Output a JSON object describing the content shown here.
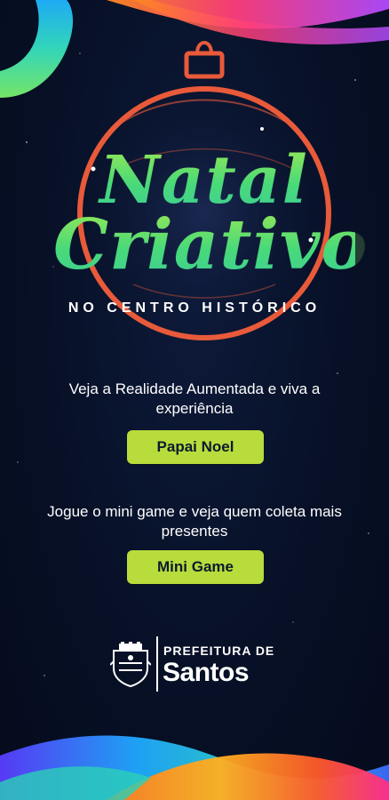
{
  "logo": {
    "line1": "Natal",
    "line2": "Criativo",
    "subtitle": "NO CENTRO HISTÓRICO"
  },
  "section1": {
    "text": "Veja a Realidade Aumentada e viva a experiência",
    "button_label": "Papai Noel"
  },
  "section2": {
    "text": "Jogue o mini game e veja quem coleta mais presentes",
    "button_label": "Mini Game"
  },
  "footer": {
    "small_text": "PREFEITURA DE",
    "big_text": "Santos"
  },
  "colors": {
    "background": "#071026",
    "button": "#b8dc3c",
    "button_text": "#0b1a2e",
    "ornament_ring": "#e85a3a",
    "logo_green": "#33d17a"
  }
}
